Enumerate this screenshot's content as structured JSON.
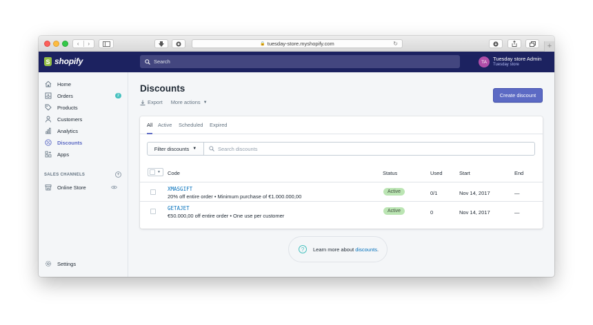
{
  "browser": {
    "url": "tuesday-store.myshopify.com",
    "back_icon": "‹",
    "forward_icon": "›"
  },
  "topbar": {
    "brand": "shopify",
    "search_placeholder": "Search",
    "account_name": "Tuesday store Admin",
    "account_store": "Tuesday store",
    "avatar_initials": "TA"
  },
  "sidebar": {
    "items": [
      {
        "label": "Home",
        "icon": "home-icon"
      },
      {
        "label": "Orders",
        "icon": "orders-icon",
        "badge": "2"
      },
      {
        "label": "Products",
        "icon": "tag-icon"
      },
      {
        "label": "Customers",
        "icon": "person-icon"
      },
      {
        "label": "Analytics",
        "icon": "bar-chart-icon"
      },
      {
        "label": "Discounts",
        "icon": "discount-icon",
        "active": true
      },
      {
        "label": "Apps",
        "icon": "apps-icon"
      }
    ],
    "sales_channels_label": "SALES CHANNELS",
    "online_store": "Online Store",
    "settings": "Settings"
  },
  "main": {
    "title": "Discounts",
    "export_label": "Export",
    "more_actions_label": "More actions",
    "create_button": "Create discount",
    "tabs": [
      "All",
      "Active",
      "Scheduled",
      "Expired"
    ],
    "filter_button": "Filter discounts",
    "search_placeholder": "Search discounts",
    "columns": {
      "code": "Code",
      "status": "Status",
      "used": "Used",
      "start": "Start",
      "end": "End"
    },
    "rows": [
      {
        "code": "XMASGIFT",
        "description": "20% off entire order • Minimum purchase of €1.000.000,00",
        "status": "Active",
        "used": "0/1",
        "start": "Nov 14, 2017",
        "end": "—"
      },
      {
        "code": "GETAJET",
        "description": "€50.000,00 off entire order • One use per customer",
        "status": "Active",
        "used": "0",
        "start": "Nov 14, 2017",
        "end": "—"
      }
    ],
    "learn_prefix": "Learn more about ",
    "learn_link": "discounts",
    "learn_suffix": "."
  },
  "colors": {
    "accent": "#5c6ac4",
    "topbar": "#1c2260",
    "status_active": "#bbe5b3",
    "link": "#006fbb"
  }
}
